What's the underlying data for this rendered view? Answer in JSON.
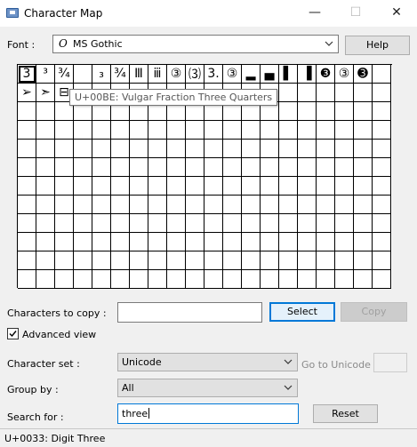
{
  "window": {
    "title": "Character Map",
    "icon": "charmap-icon",
    "minimize_glyph": "—",
    "maximize_glyph": "☐",
    "close_glyph": "✕"
  },
  "font": {
    "label": "Font :",
    "opentype_glyph": "O",
    "value": "MS Gothic",
    "help_label": "Help"
  },
  "grid": {
    "cells": [
      "3",
      "³",
      "¾",
      "",
      "₃",
      "¾",
      "Ⅲ",
      "ⅲ",
      "③",
      "⑶",
      "3.",
      "③",
      "▂",
      "▄",
      "▌",
      "▐",
      "❸",
      "③",
      "➌",
      "",
      "➢",
      "➣",
      "⊟"
    ]
  },
  "tooltip": "U+00BE: Vulgar Fraction Three Quarters",
  "copy": {
    "label": "Characters to copy :",
    "value": "",
    "select_label": "Select",
    "copy_label": "Copy"
  },
  "advanced": {
    "label": "Advanced view",
    "checked": true
  },
  "charset": {
    "label": "Character set :",
    "value": "Unicode",
    "goto_label": "Go to Unicode :",
    "goto_value": ""
  },
  "groupby": {
    "label": "Group by :",
    "value": "All"
  },
  "search": {
    "label": "Search for :",
    "value": "three",
    "reset_label": "Reset"
  },
  "status": "U+0033: Digit Three"
}
